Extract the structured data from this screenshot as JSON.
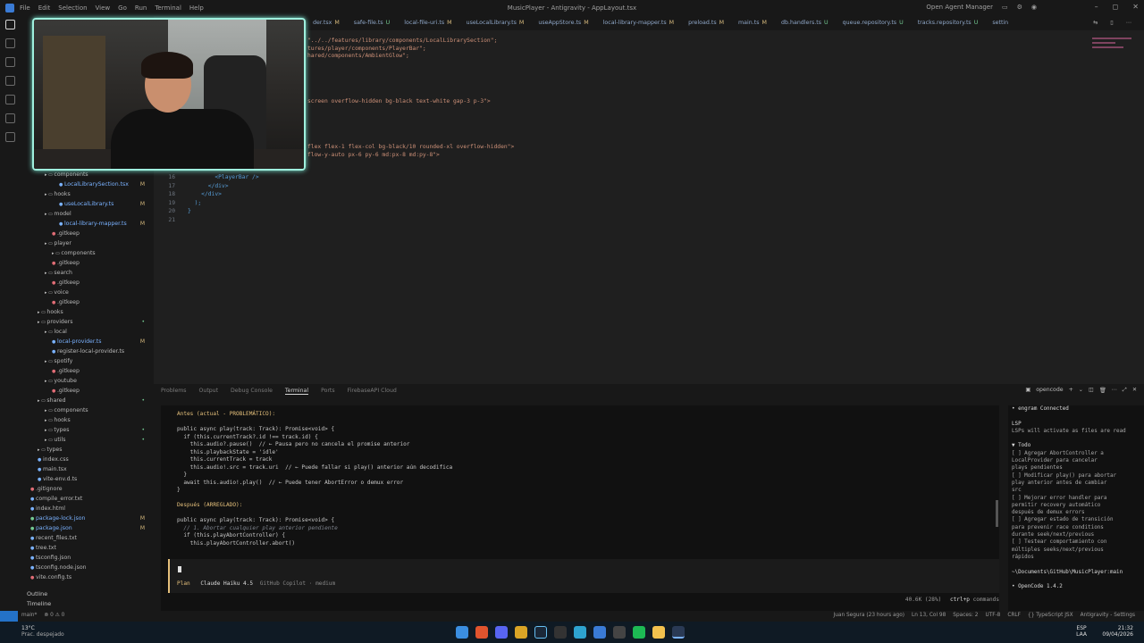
{
  "titlebar": {
    "menus": [
      "File",
      "Edit",
      "Selection",
      "View",
      "Go",
      "Run",
      "Terminal",
      "Help"
    ],
    "title": "MusicPlayer - Antigravity - AppLayout.tsx",
    "open_agent_manager": "Open Agent Manager",
    "controls": [
      "–",
      "◻",
      "✕"
    ]
  },
  "tabs": [
    {
      "label": "der.tsx",
      "status": "M"
    },
    {
      "label": "safe-file.ts",
      "status": "U"
    },
    {
      "label": "local-file-uri.ts",
      "status": "M"
    },
    {
      "label": "useLocalLibrary.ts",
      "status": "M"
    },
    {
      "label": "useAppStore.ts",
      "status": "M"
    },
    {
      "label": "local-library-mapper.ts",
      "status": "M"
    },
    {
      "label": "preload.ts",
      "status": "M"
    },
    {
      "label": "main.ts",
      "status": "M"
    },
    {
      "label": "db.handlers.ts",
      "status": "U"
    },
    {
      "label": "queue.repository.ts",
      "status": "U"
    },
    {
      "label": "tracks.repository.ts",
      "status": "U"
    },
    {
      "label": "settin",
      "status": ""
    }
  ],
  "editor": {
    "lines_top": [
      "\"../../features/library/components/LocalLibrarySection\";",
      "tures/player/components/PlayerBar\";",
      "hared/components/AmbientGlow\";",
      "",
      "",
      "",
      "",
      "",
      "screen overflow-hidden bg-black text-white gap-3 p-3\">",
      "",
      "",
      "",
      "",
      "",
      "flex flex-1 flex-col bg-black/10 rounded-xl overflow-hidden\">",
      "flow-y-auto px-6 py-6 md:px-8 md:py-8\">"
    ],
    "gutter": [
      {
        "num": "16",
        "text": "        <PlayerBar />"
      },
      {
        "num": "17",
        "text": "      </div>"
      },
      {
        "num": "18",
        "text": "    </div>"
      },
      {
        "num": "19",
        "text": "  );"
      },
      {
        "num": "20",
        "text": "}"
      },
      {
        "num": "21",
        "text": ""
      }
    ]
  },
  "explorer": [
    {
      "label": "components",
      "kind": "fold",
      "indent": 2,
      "badge": ""
    },
    {
      "label": "LocalLibrarySection.tsx",
      "kind": "ts",
      "indent": 4,
      "badge": "M"
    },
    {
      "label": "hooks",
      "kind": "fold",
      "indent": 2,
      "badge": ""
    },
    {
      "label": "useLocalLibrary.ts",
      "kind": "ts",
      "indent": 4,
      "badge": "M"
    },
    {
      "label": "model",
      "kind": "fold",
      "indent": 2,
      "badge": ""
    },
    {
      "label": "local-library-mapper.ts",
      "kind": "ts",
      "indent": 4,
      "badge": "M"
    },
    {
      "label": ".gitkeep",
      "kind": "git",
      "indent": 3,
      "badge": ""
    },
    {
      "label": "player",
      "kind": "fold",
      "indent": 2,
      "badge": ""
    },
    {
      "label": "components",
      "kind": "fold",
      "indent": 3,
      "badge": ""
    },
    {
      "label": ".gitkeep",
      "kind": "git",
      "indent": 3,
      "badge": ""
    },
    {
      "label": "search",
      "kind": "fold",
      "indent": 2,
      "badge": ""
    },
    {
      "label": ".gitkeep",
      "kind": "git",
      "indent": 3,
      "badge": ""
    },
    {
      "label": "voice",
      "kind": "fold",
      "indent": 2,
      "badge": ""
    },
    {
      "label": ".gitkeep",
      "kind": "git",
      "indent": 3,
      "badge": ""
    },
    {
      "label": "hooks",
      "kind": "fold",
      "indent": 1,
      "badge": ""
    },
    {
      "label": "providers",
      "kind": "fold",
      "indent": 1,
      "badge": "•"
    },
    {
      "label": "local",
      "kind": "fold",
      "indent": 2,
      "badge": ""
    },
    {
      "label": "local-provider.ts",
      "kind": "ts",
      "indent": 3,
      "badge": "M"
    },
    {
      "label": "register-local-provider.ts",
      "kind": "ts",
      "indent": 3,
      "badge": ""
    },
    {
      "label": "spotify",
      "kind": "fold",
      "indent": 2,
      "badge": ""
    },
    {
      "label": ".gitkeep",
      "kind": "git",
      "indent": 3,
      "badge": ""
    },
    {
      "label": "youtube",
      "kind": "fold",
      "indent": 2,
      "badge": ""
    },
    {
      "label": ".gitkeep",
      "kind": "git",
      "indent": 3,
      "badge": ""
    },
    {
      "label": "shared",
      "kind": "fold",
      "indent": 1,
      "badge": "•"
    },
    {
      "label": "components",
      "kind": "fold",
      "indent": 2,
      "badge": ""
    },
    {
      "label": "hooks",
      "kind": "fold",
      "indent": 2,
      "badge": ""
    },
    {
      "label": "types",
      "kind": "fold",
      "indent": 2,
      "badge": "•"
    },
    {
      "label": "utils",
      "kind": "fold",
      "indent": 2,
      "badge": "•"
    },
    {
      "label": "types",
      "kind": "fold",
      "indent": 1,
      "badge": ""
    },
    {
      "label": "index.css",
      "kind": "ts",
      "indent": 1,
      "badge": ""
    },
    {
      "label": "main.tsx",
      "kind": "ts",
      "indent": 1,
      "badge": ""
    },
    {
      "label": "vite-env.d.ts",
      "kind": "ts",
      "indent": 1,
      "badge": ""
    },
    {
      "label": ".gitignore",
      "kind": "git",
      "indent": 0,
      "badge": ""
    },
    {
      "label": "compile_error.txt",
      "kind": "plain",
      "indent": 0,
      "badge": ""
    },
    {
      "label": "index.html",
      "kind": "plain",
      "indent": 0,
      "badge": ""
    },
    {
      "label": "package-lock.json",
      "kind": "new",
      "indent": 0,
      "badge": "M"
    },
    {
      "label": "package.json",
      "kind": "new",
      "indent": 0,
      "badge": "M"
    },
    {
      "label": "recent_files.txt",
      "kind": "plain",
      "indent": 0,
      "badge": ""
    },
    {
      "label": "tree.txt",
      "kind": "plain",
      "indent": 0,
      "badge": ""
    },
    {
      "label": "tsconfig.json",
      "kind": "plain",
      "indent": 0,
      "badge": ""
    },
    {
      "label": "tsconfig.node.json",
      "kind": "plain",
      "indent": 0,
      "badge": ""
    },
    {
      "label": "vite.config.ts",
      "kind": "git",
      "indent": 0,
      "badge": ""
    }
  ],
  "sidebar_bottom": {
    "outline": "Outline",
    "timeline": "Timeline"
  },
  "panel": {
    "tabs": [
      "Problems",
      "Output",
      "Debug Console",
      "Terminal",
      "Ports",
      "FirebaseAPI Cloud"
    ],
    "active_tab": "Terminal",
    "terminal_name": "opencode"
  },
  "terminal": {
    "lines": [
      {
        "t": "Antes (actual - PROBLEMÁTICO):",
        "c": "yel"
      },
      {
        "t": "",
        "c": ""
      },
      {
        "t": "public async play(track: Track): Promise<void> {",
        "c": ""
      },
      {
        "t": "  if (this.currentTrack?.id !== track.id) {",
        "c": ""
      },
      {
        "t": "    this.audio?.pause()  // ← Pausa pero no cancela el promise anterior",
        "c": ""
      },
      {
        "t": "    this.playbackState = 'idle'",
        "c": ""
      },
      {
        "t": "    this.currentTrack = track",
        "c": ""
      },
      {
        "t": "    this.audio!.src = track.uri  // ← Puede fallar si play() anterior aún decodifica",
        "c": ""
      },
      {
        "t": "  }",
        "c": ""
      },
      {
        "t": "  await this.audio!.play()  // ← Puede tener AbortError o demux error",
        "c": ""
      },
      {
        "t": "}",
        "c": ""
      },
      {
        "t": "",
        "c": ""
      },
      {
        "t": "Después (ARREGLADO):",
        "c": "yel"
      },
      {
        "t": "",
        "c": ""
      },
      {
        "t": "public async play(track: Track): Promise<void> {",
        "c": ""
      },
      {
        "t": "  // 1. Abortar cualquier play anterior pendiente",
        "c": "cmt"
      },
      {
        "t": "  if (this.playAbortController) {",
        "c": ""
      },
      {
        "t": "    this.playAbortController.abort()",
        "c": ""
      }
    ],
    "mode": "Plan",
    "model": "Claude Haiku 4.5",
    "provider": "GitHub Copilot · medium",
    "tokens": "40.6K (28%)",
    "shortcut_key": "ctrl+p",
    "shortcut_label": "commands"
  },
  "opencode_side": {
    "lines": [
      {
        "t": "• engram Connected",
        "c": "hd"
      },
      {
        "t": "",
        "c": ""
      },
      {
        "t": "LSP",
        "c": "hd"
      },
      {
        "t": "LSPs will activate as files are read",
        "c": ""
      },
      {
        "t": "",
        "c": ""
      },
      {
        "t": "▼ Todo",
        "c": "hd"
      },
      {
        "t": "[ ] Agregar AbortController a",
        "c": ""
      },
      {
        "t": "    LocalProvider para cancelar",
        "c": ""
      },
      {
        "t": "    plays pendientes",
        "c": ""
      },
      {
        "t": "[ ] Modificar play() para abortar",
        "c": ""
      },
      {
        "t": "    play anterior antes de cambiar",
        "c": ""
      },
      {
        "t": "    src",
        "c": ""
      },
      {
        "t": "[ ] Mejorar error handler para",
        "c": ""
      },
      {
        "t": "    permitir recovery automático",
        "c": ""
      },
      {
        "t": "    después de demux errors",
        "c": ""
      },
      {
        "t": "[ ] Agregar estado de transición",
        "c": ""
      },
      {
        "t": "    para prevenir race conditions",
        "c": ""
      },
      {
        "t": "    durante seek/next/previous",
        "c": ""
      },
      {
        "t": "[ ] Testear comportamiento con",
        "c": ""
      },
      {
        "t": "    múltiples seeks/next/previous",
        "c": ""
      },
      {
        "t": "    rápidos",
        "c": ""
      },
      {
        "t": "",
        "c": ""
      },
      {
        "t": "~\\Documents\\GitHub\\MusicPlayer:main",
        "c": "hd"
      },
      {
        "t": "",
        "c": ""
      },
      {
        "t": "• OpenCode 1.4.2",
        "c": "hd"
      }
    ]
  },
  "statusbar": {
    "left": [
      "main*",
      "⊗ 0 ⚠ 0"
    ],
    "right": [
      "Juan Segura (23 hours ago)",
      "Ln 13, Col 98",
      "Spaces: 2",
      "UTF-8",
      "CRLF",
      "{} TypeScript JSX",
      "Antigravity - Settings"
    ]
  },
  "taskbar": {
    "weather_temp": "13°C",
    "weather_desc": "Prac. despejado",
    "lang1": "ESP",
    "lang2": "LAA",
    "time": "21:32",
    "date": "09/04/2026"
  }
}
